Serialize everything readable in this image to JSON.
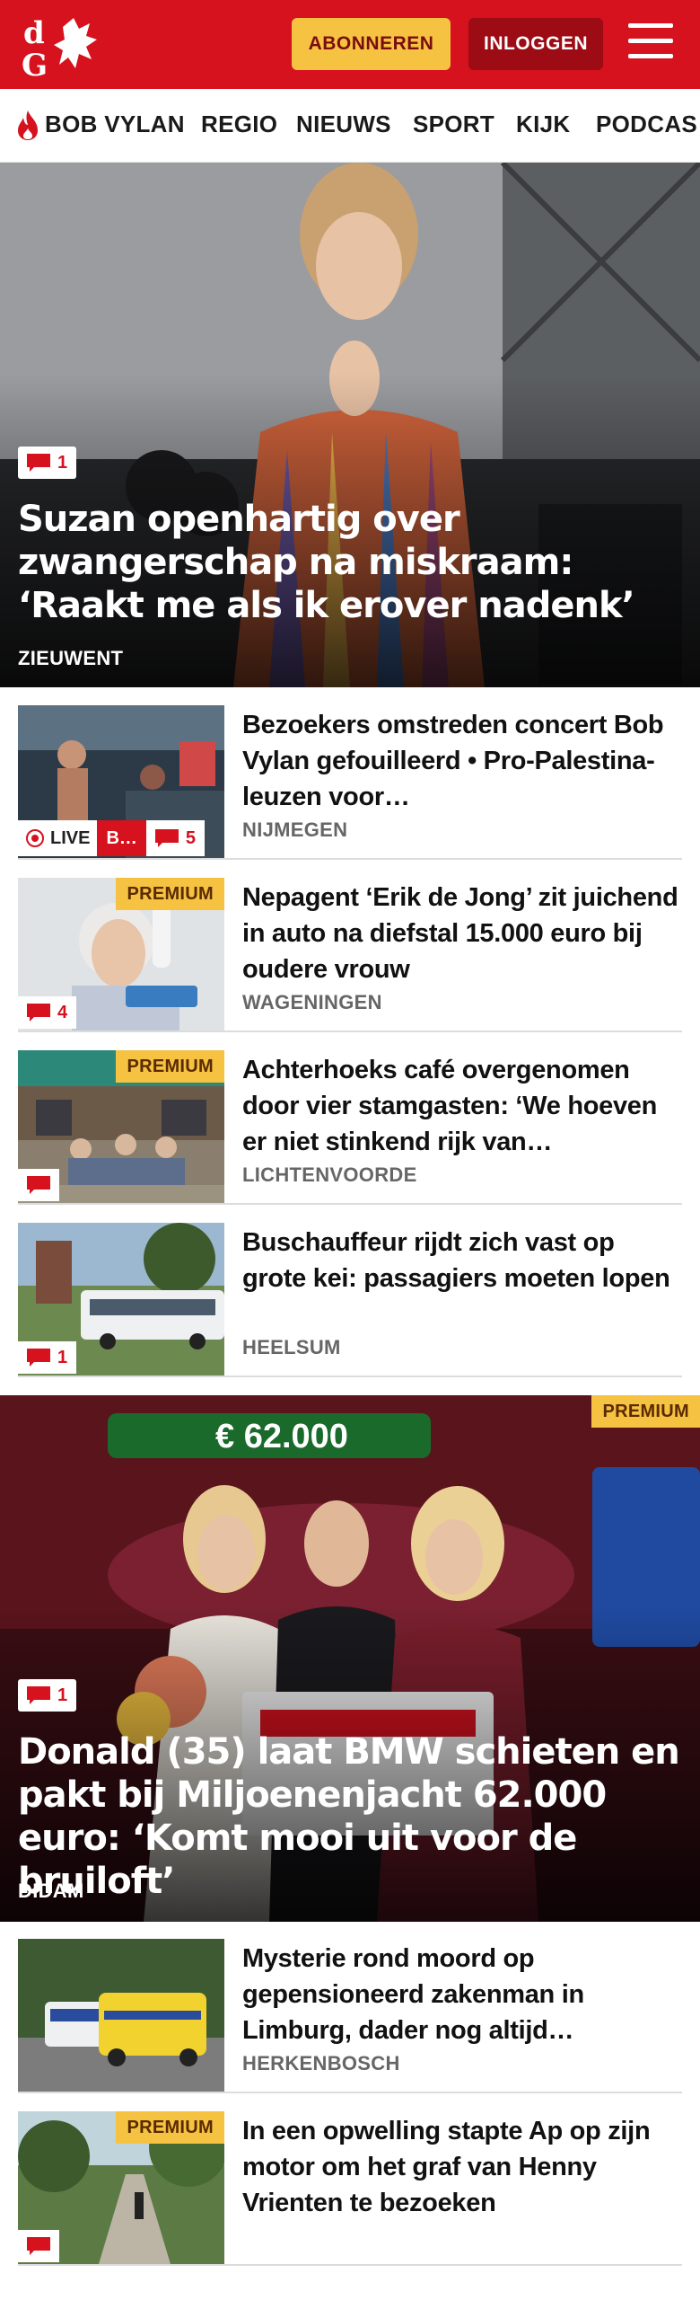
{
  "header": {
    "logo_text": "dG",
    "subscribe_label": "ABONNEREN",
    "login_label": "INLOGGEN"
  },
  "nav": {
    "items": [
      "BOB VYLAN",
      "REGIO",
      "NIEUWS",
      "SPORT",
      "KIJK",
      "PODCAS"
    ]
  },
  "colors": {
    "brand": "#d5121e",
    "premium": "#f5c242",
    "login": "#9d0b14"
  },
  "hero1": {
    "comments": "1",
    "title": "Suzan openhartig over zwangerschap na miskraam: ‘Raakt me als ik erover nadenk’",
    "location": "ZIEUWENT"
  },
  "list1": [
    {
      "title": "Bezoekers omstreden concert Bob Vylan gefouilleerd • Pro-Palestina-leuzen voor…",
      "location": "NIJMEGEN",
      "live": "LIVE",
      "live_tag": "B…",
      "comments": "5",
      "premium": ""
    },
    {
      "title": "Nepagent ‘Erik de Jong’ zit juichend in auto na diefstal 15.000 euro bij oudere vrouw",
      "location": "WAGENINGEN",
      "comments": "4",
      "premium": "PREMIUM"
    },
    {
      "title": "Achterhoeks café overgenomen door vier stamgasten: ‘We hoeven er niet stinkend rijk van…",
      "location": "LICHTENVOORDE",
      "comments": "",
      "premium": "PREMIUM"
    },
    {
      "title": "Buschauffeur rijdt zich vast op grote kei: passagiers moeten lopen",
      "location": "HEELSUM",
      "comments": "1",
      "premium": ""
    }
  ],
  "hero2": {
    "premium": "PREMIUM",
    "comments": "1",
    "title": "Donald (35) laat BMW schieten en pakt bij Miljoenenjacht 62.000 euro: ‘Komt mooi uit voor de bruiloft’",
    "location": "DIDAM",
    "sign_text": "€ 62.000"
  },
  "list2": [
    {
      "title": "Mysterie rond moord op gepensioneerd zakenman in Limburg, dader nog altijd…",
      "location": "HERKENBOSCH",
      "premium": ""
    },
    {
      "title": "In een opwelling stapte Ap op zijn motor om het graf van Henny Vrienten te bezoeken",
      "location": "",
      "premium": "PREMIUM",
      "comments": ""
    }
  ]
}
